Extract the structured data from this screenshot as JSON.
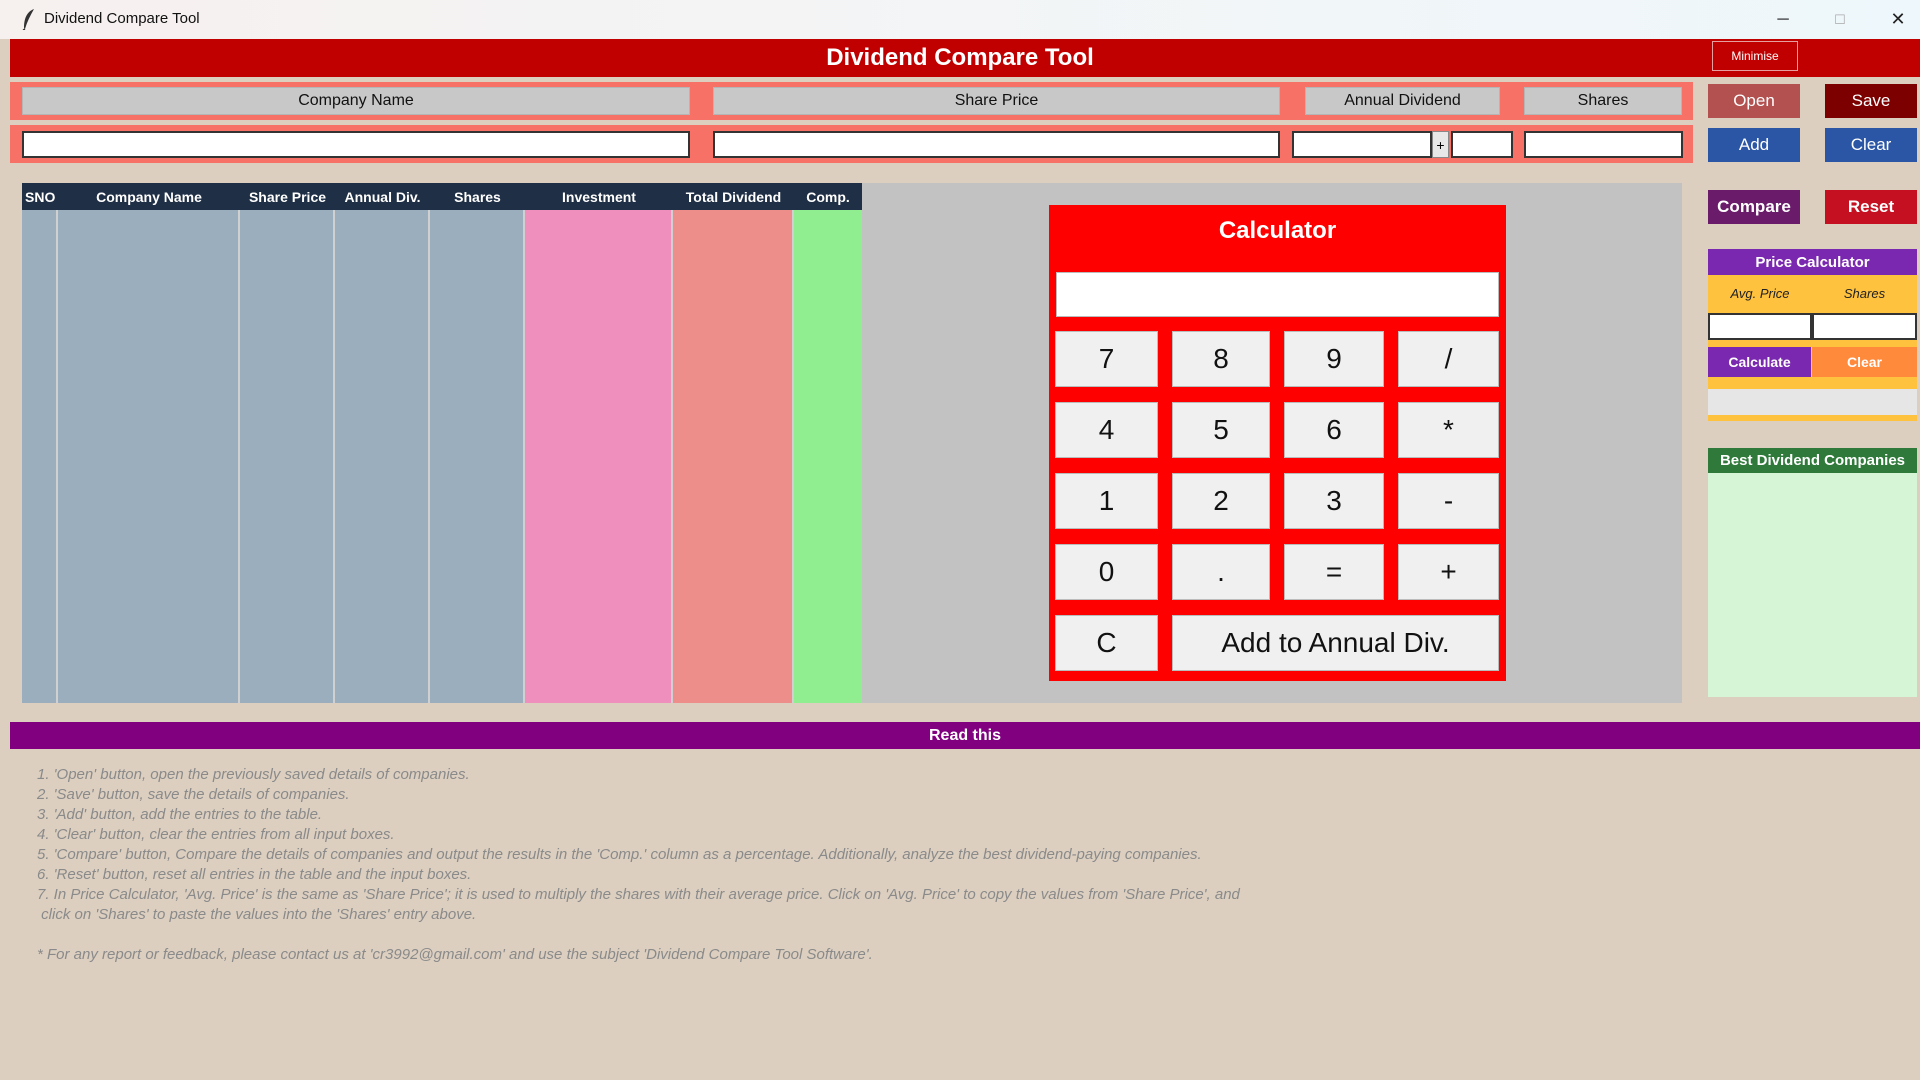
{
  "window": {
    "title": "Dividend Compare Tool",
    "minimize_glyph": "─",
    "maximize_glyph": "☐",
    "close_glyph": "✕"
  },
  "header": {
    "title": "Dividend Compare Tool",
    "minimise_label": "Minimise"
  },
  "inputs": {
    "company_name_label": "Company Name",
    "share_price_label": "Share Price",
    "annual_dividend_label": "Annual Dividend",
    "shares_label": "Shares",
    "plus_label": "+",
    "company_name_value": "",
    "share_price_value": "",
    "annual_dividend_value": "",
    "annual_dividend_extra_value": "",
    "shares_value": ""
  },
  "actions": {
    "open": "Open",
    "save": "Save",
    "add": "Add",
    "clear": "Clear",
    "compare": "Compare",
    "reset": "Reset"
  },
  "table": {
    "columns": [
      "SNO",
      "Company Name",
      "Share Price",
      "Annual Div.",
      "Shares",
      "Investment",
      "Total Dividend",
      "Comp."
    ],
    "rows": []
  },
  "calculator": {
    "title": "Calculator",
    "display": "",
    "keys": [
      "7",
      "8",
      "9",
      "/",
      "4",
      "5",
      "6",
      "*",
      "1",
      "2",
      "3",
      "-",
      "0",
      ".",
      "=",
      "+"
    ],
    "clear_key": "C",
    "add_key": "Add to Annual Div."
  },
  "price_calculator": {
    "title": "Price Calculator",
    "avg_price_label": "Avg. Price",
    "shares_label": "Shares",
    "avg_price_value": "",
    "shares_value": "",
    "calculate_label": "Calculate",
    "clear_label": "Clear",
    "result": ""
  },
  "best_dividend": {
    "title": "Best Dividend Companies",
    "items": []
  },
  "read_this": {
    "title": "Read this",
    "lines": [
      "1. 'Open' button, open the previously saved details of companies.",
      "2. 'Save' button, save the details of companies.",
      "3. 'Add' button, add the entries to the table.",
      "4. 'Clear' button, clear the entries from all input boxes.",
      "5. 'Compare' button, Compare the details of companies and output the results in the 'Comp.' column as a percentage. Additionally, analyze the best dividend-paying companies.",
      "6. 'Reset' button, reset all entries in the table and the input boxes.",
      "7. In Price Calculator, 'Avg. Price' is the same as 'Share Price'; it is used to multiply the shares with their average price. Click on 'Avg. Price' to copy the values from 'Share Price', and",
      " click on 'Shares' to paste the values into the 'Shares' entry above."
    ],
    "footer": "* For any report or feedback, please contact us at 'cr3992@gmail.com' and use the subject 'Dividend Compare Tool Software'."
  },
  "colors": {
    "header_red": "#c00000",
    "strip_salmon": "#f87167",
    "calc_red": "#ff0000",
    "table_header": "#1f2f45",
    "col_gray": "#9aaebd",
    "col_pink": "#ee8fbd",
    "col_salmon": "#ee8e8a",
    "col_green": "#90ee90",
    "purple": "#800080"
  }
}
